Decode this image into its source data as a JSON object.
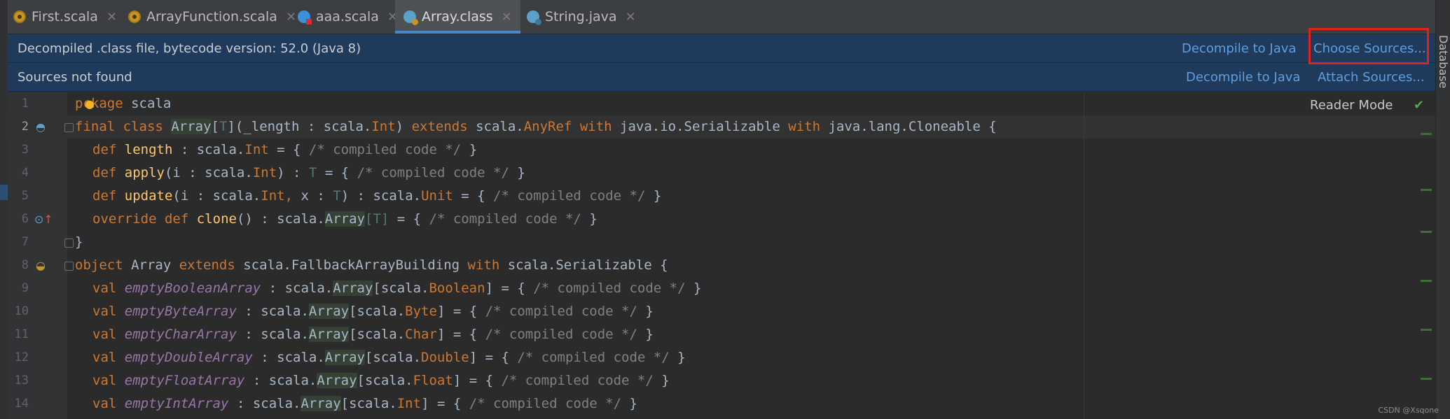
{
  "tabs": [
    {
      "label": "First.scala",
      "icon": "scala-file-icon"
    },
    {
      "label": "ArrayFunction.scala",
      "icon": "scala-file-icon"
    },
    {
      "label": "aaa.scala",
      "icon": "scala-worksheet-icon"
    },
    {
      "label": "Array.class",
      "icon": "class-file-icon",
      "active": true
    },
    {
      "label": "String.java",
      "icon": "java-class-icon"
    }
  ],
  "banner_decompiled": {
    "message": "Decompiled .class file, bytecode version: 52.0 (Java 8)",
    "decompile_link": "Decompile to Java",
    "choose_link": "Choose Sources..."
  },
  "banner_sources": {
    "message": "Sources not found",
    "decompile_link": "Decompile to Java",
    "attach_link": "Attach Sources..."
  },
  "reader_mode": "Reader Mode",
  "sidebar_label": "Database",
  "watermark": "CSDN @Xsqone",
  "line_numbers": [
    "1",
    "2",
    "3",
    "4",
    "5",
    "6",
    "7",
    "8",
    "9",
    "10",
    "11",
    "12",
    "13",
    "14"
  ],
  "code": {
    "l1": {
      "p": "p",
      "rest": "ckage ",
      "name": "scala"
    },
    "l2": {
      "final": "final",
      "class": "class",
      "name": "Array",
      "tparam": "T",
      "params": "(_length : scala.",
      "int": "Int",
      "close": ") ",
      "extends": "extends",
      "anyref_pre": " scala.",
      "anyref": "AnyRef",
      "with1": "with",
      "ser": " java.io.Serializable ",
      "with2": "with",
      "clone": " java.lang.Cloneable {"
    },
    "l3": {
      "def": "def",
      "name": "length",
      "mid": " : scala.",
      "type": "Int",
      "eq": " = { ",
      "cm": "/* compiled code */",
      "end": " }"
    },
    "l4": {
      "def": "def",
      "name": "apply",
      "mid": "(i : scala.",
      "type": "Int",
      "mid2": ") : ",
      "tv": "T",
      "eq": " = { ",
      "cm": "/* compiled code */",
      "end": " }"
    },
    "l5": {
      "def": "def",
      "name": "update",
      "mid": "(i : scala.",
      "type": "Int,",
      "mid2": " x : ",
      "tv": "T",
      "mid3": ") : scala.",
      "type2": "Unit",
      "eq": " = { ",
      "cm": "/* compiled code */",
      "end": " }"
    },
    "l6": {
      "override": "override",
      "def": "def",
      "name": "clone",
      "mid": "() : scala.",
      "arr": "Array",
      "tp": "[T]",
      "eq": " = { ",
      "cm": "/* compiled code */",
      "end": " }"
    },
    "l7": {
      "brace": "}"
    },
    "l8": {
      "object": "object",
      "name": " Array ",
      "extends": "extends",
      "mid": " scala.FallbackArrayBuilding ",
      "with": "with",
      "end": " scala.Serializable {"
    },
    "vals": [
      {
        "val": "val",
        "name": "emptyBooleanArray",
        "type": "Boolean"
      },
      {
        "val": "val",
        "name": "emptyByteArray",
        "type": "Byte"
      },
      {
        "val": "val",
        "name": "emptyCharArray",
        "type": "Char"
      },
      {
        "val": "val",
        "name": "emptyDoubleArray",
        "type": "Double"
      },
      {
        "val": "val",
        "name": "emptyFloatArray",
        "type": "Float"
      },
      {
        "val": "val",
        "name": "emptyIntArray",
        "type": "Int"
      }
    ],
    "val_parts": {
      "mid": " : scala.",
      "arr": "Array",
      "open": "[scala.",
      "close": "] = { ",
      "cm": "/* compiled code */",
      "end": " }"
    }
  },
  "colors": {
    "keyword": "#cc7832",
    "function": "#ffc66d",
    "field": "#9876aa",
    "comment": "#808080",
    "link": "#5e9fe0",
    "highlight_box": "#e0221f"
  }
}
